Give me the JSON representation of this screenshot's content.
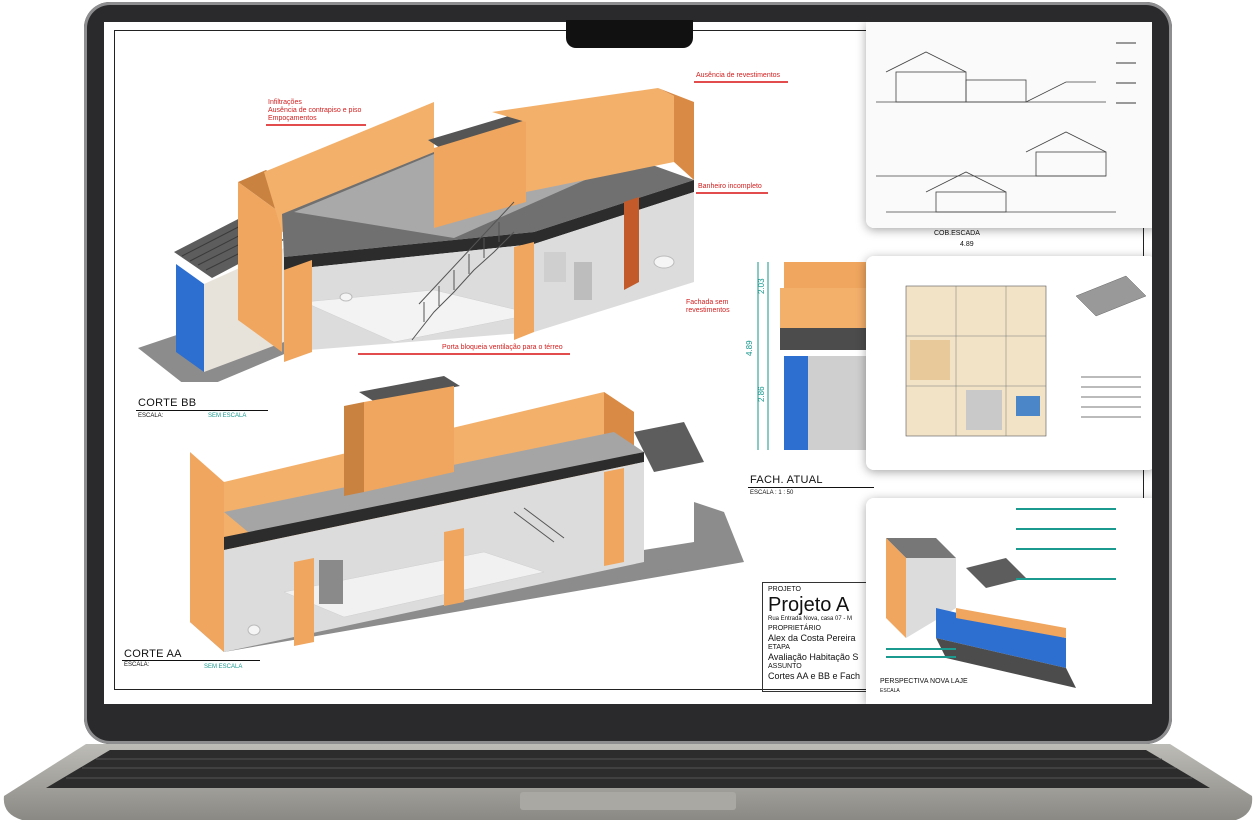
{
  "labels": {
    "infiltracoes": [
      "Infiltrações",
      "Ausência de contrapiso e piso",
      "Empoçamentos"
    ],
    "ausencia_revestimentos": "Ausência de revestimentos",
    "banheiro_incompleto": "Banheiro incompleto",
    "fachada_sem_revestimentos": [
      "Fachada sem",
      "revestimentos"
    ],
    "porta_bloqueia": "Porta bloqueia ventilação para o térreo"
  },
  "corte_bb": {
    "title": "CORTE BB",
    "escala_label": "ESCALA:",
    "escala_value": "SEM ESCALA"
  },
  "corte_aa": {
    "title": "CORTE AA",
    "escala_label": "ESCALA:",
    "escala_value": "SEM ESCALA"
  },
  "fachada": {
    "title": "FACH. ATUAL",
    "escala": "ESCALA : 1 : 50",
    "dim_total": "4.89",
    "dim_upper": "2.03",
    "dim_lower": "2.86",
    "cob_escada": "COB.ESCADA",
    "cob_value": "4.89"
  },
  "title_block": {
    "projeto_label": "PROJETO",
    "projeto_value": "Projeto A",
    "address": "Rua Entrada Nova, casa 07 - M",
    "proprietario_label": "PROPRIETÁRIO",
    "proprietario_value": "Alex da Costa Pereira",
    "etapa_label": "ETAPA",
    "etapa_value": "Avaliação Habitação S",
    "assunto_label": "ASSUNTO",
    "assunto_value": "Cortes AA e BB e Fach"
  },
  "thumb_perspectiva": {
    "title": "PERSPECTIVA NOVA LAJE",
    "escala": "ESCALA"
  },
  "colors": {
    "wall": "#f0a65e",
    "wall_dark": "#d98a45",
    "slab": "#2c2c2c",
    "door_blue": "#1f6fd1",
    "floor": "#e9e9e9",
    "annotation": "#d21f1f",
    "dimension": "#15968b"
  }
}
